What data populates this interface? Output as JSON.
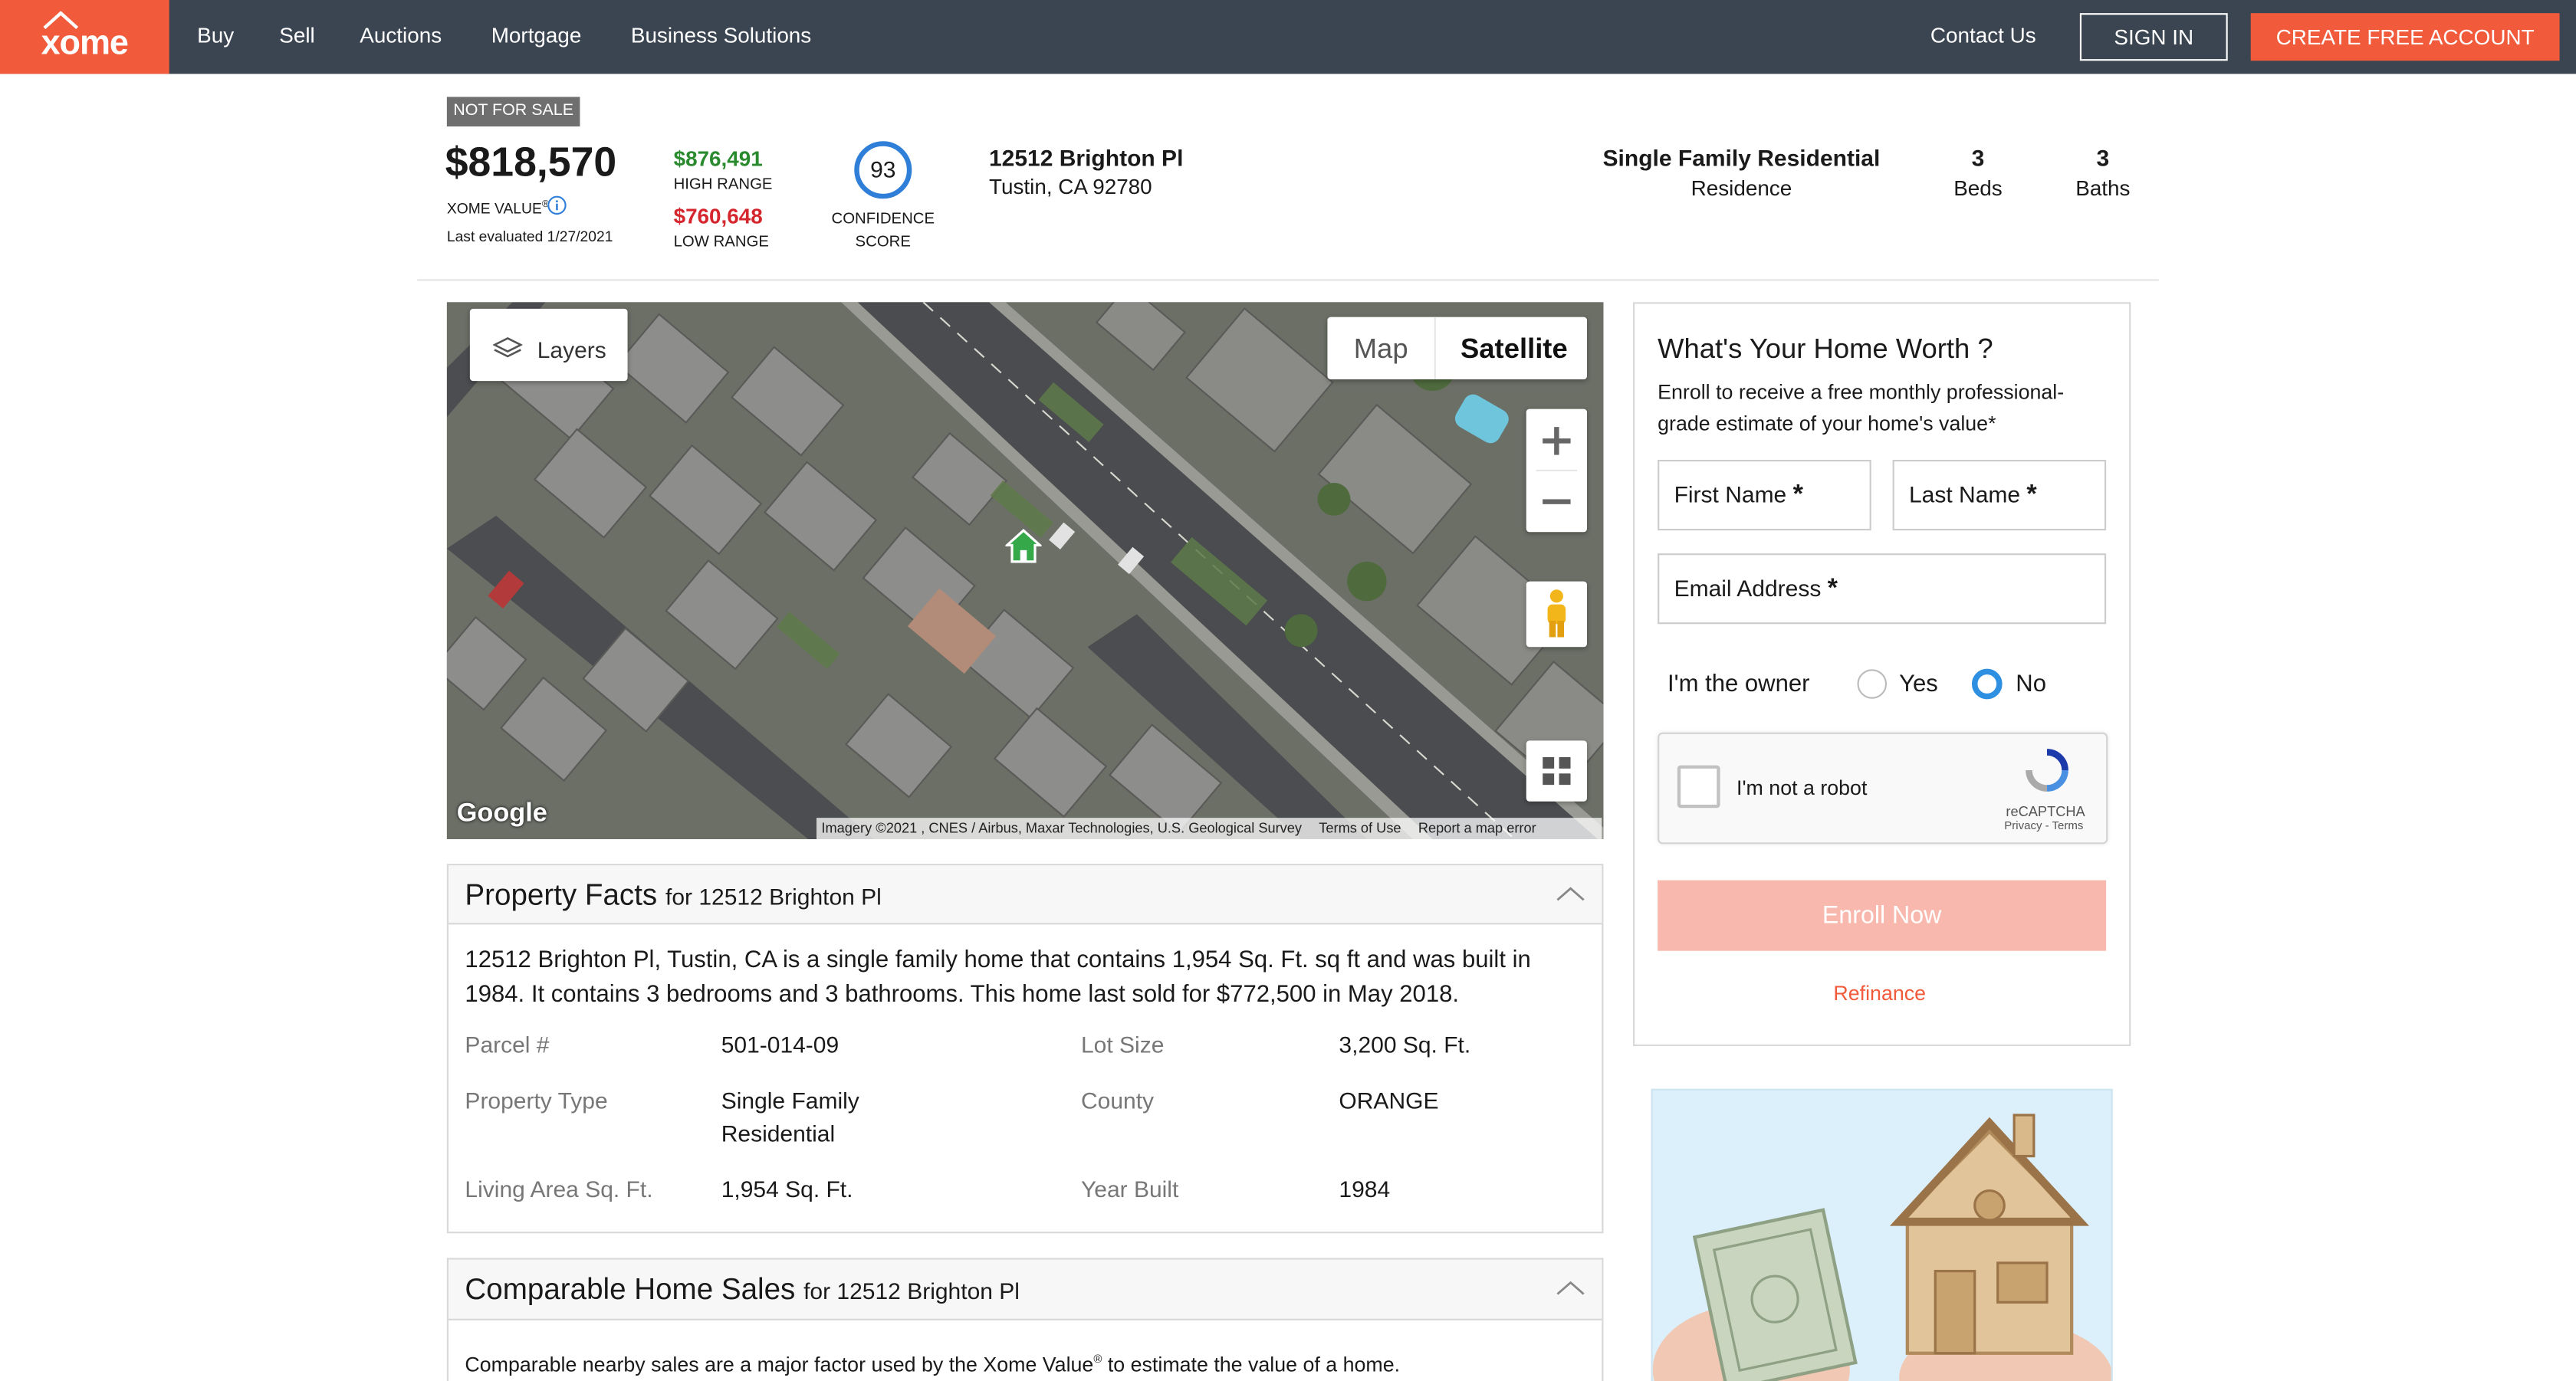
{
  "header": {
    "logo_text": "xome",
    "nav": [
      "Buy",
      "Sell",
      "Auctions",
      "Mortgage",
      "Business Solutions"
    ],
    "contact": "Contact Us",
    "sign_in": "SIGN IN",
    "create_account": "CREATE FREE ACCOUNT"
  },
  "summary": {
    "status_badge": "NOT FOR SALE",
    "value": "$818,570",
    "value_label": "XOME VALUE",
    "value_label_sup": "®",
    "last_evaluated": "Last evaluated 1/27/2021",
    "high": "$876,491",
    "high_label": "HIGH RANGE",
    "low": "$760,648",
    "low_label": "LOW RANGE",
    "confidence": "93",
    "confidence_label_1": "CONFIDENCE",
    "confidence_label_2": "SCORE",
    "address_line1": "12512 Brighton Pl",
    "address_line2": "Tustin, CA 92780",
    "property_type": "Single Family Residential",
    "property_subtype": "Residence",
    "beds": "3",
    "beds_label": "Beds",
    "baths": "3",
    "baths_label": "Baths"
  },
  "map": {
    "layers_label": "Layers",
    "map_tab": "Map",
    "satellite_tab": "Satellite",
    "google_logo": "Google",
    "imagery": "Imagery ©2021 , CNES / Airbus, Maxar Technologies, U.S. Geological Survey",
    "terms": "Terms of Use",
    "report": "Report a map error"
  },
  "property_facts": {
    "title": "Property Facts",
    "for_label": "for 12512 Brighton Pl",
    "description_line1": "12512 Brighton Pl, Tustin, CA is a single family home that contains 1,954 Sq. Ft. sq ft and was built in",
    "description_line2": "1984. It contains 3 bedrooms and 3 bathrooms. This home last sold for $772,500 in May 2018.",
    "parcel_label": "Parcel #",
    "parcel_value": "501-014-09",
    "lot_label": "Lot Size",
    "lot_value": "3,200 Sq. Ft.",
    "type_label": "Property Type",
    "type_value_1": "Single Family",
    "type_value_2": "Residential",
    "county_label": "County",
    "county_value": "ORANGE",
    "living_label": "Living Area Sq. Ft.",
    "living_value": "1,954 Sq. Ft.",
    "year_label": "Year Built",
    "year_value": "1984"
  },
  "comparable": {
    "title": "Comparable Home Sales",
    "for_label": "for 12512 Brighton Pl",
    "description_a": "Comparable nearby sales are a major factor used by the Xome Value",
    "description_sup": "®",
    "description_b": " to estimate the value of a home."
  },
  "form": {
    "title": "What's Your Home Worth ?",
    "subtitle_1": "Enroll to receive a free monthly professional-",
    "subtitle_2": "grade estimate of your home's value*",
    "first_name": "First Name",
    "last_name": "Last Name",
    "email": "Email Address",
    "required_mark": "*",
    "owner_label": "I'm the owner",
    "yes": "Yes",
    "no": "No",
    "captcha_label": "I'm not a robot",
    "captcha_brand": "reCAPTCHA",
    "captcha_links": "Privacy - Terms",
    "enroll": "Enroll Now",
    "refinance": "Refinance"
  },
  "colors": {
    "brand": "#f15a3b",
    "header_bg": "#3b4551",
    "high": "#2a8a2e",
    "low": "#d6262d",
    "accent_blue": "#2f7fd8",
    "enroll_disabled": "#f9b8ad"
  }
}
